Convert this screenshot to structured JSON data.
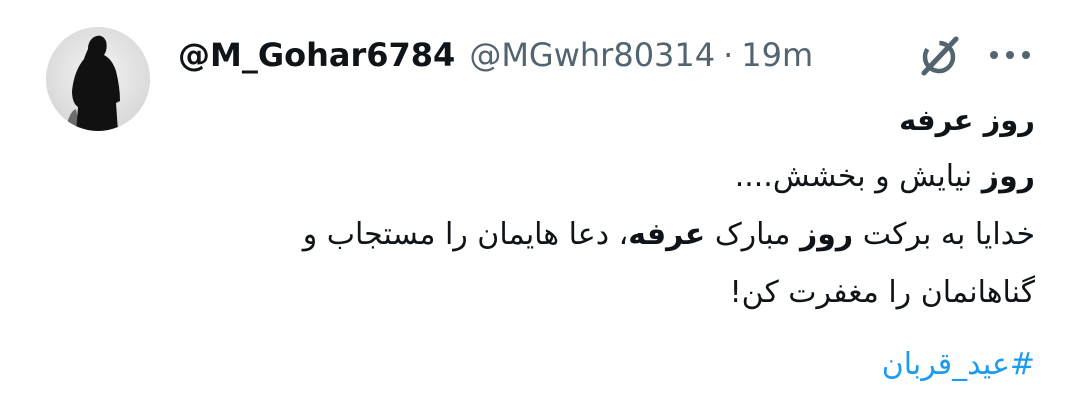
{
  "tweet": {
    "display_name": "@M_Gohar6784",
    "handle": "@MGwhr80314",
    "separator": "·",
    "time": "19m",
    "title": "روز عرفه",
    "line1_bold": "روز",
    "line1_rest": " نیایش و بخشش....",
    "line2_a": "خدایا به برکت ",
    "line2_bold1": "روز",
    "line2_b": " مبارک ",
    "line2_bold2": "عرفه",
    "line2_c": "، دعا هایمان را مستجاب و",
    "line3": "گناهانمان را مغفرت کن!",
    "hashtag": "#عید_قربان"
  },
  "icons": {
    "avatar": "profile-silhouette",
    "grok": "grok-icon",
    "more": "more-dots-icon"
  },
  "colors": {
    "text": "#0f1419",
    "secondary": "#536471",
    "link": "#1d9bf0"
  }
}
